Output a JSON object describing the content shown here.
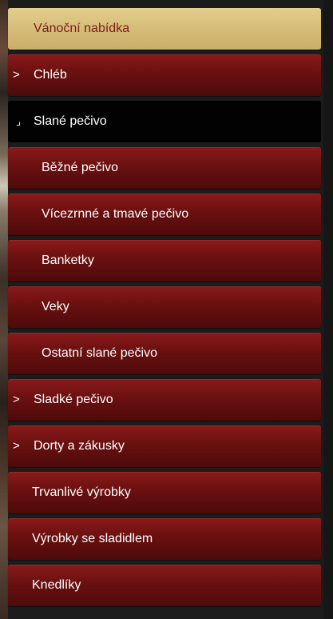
{
  "menu": {
    "items": [
      {
        "label": "Vánoční nabídka",
        "type": "highlight",
        "arrow": ""
      },
      {
        "label": "Chléb",
        "type": "top",
        "arrow": ">"
      },
      {
        "label": "Slané pečivo",
        "type": "active",
        "arrow": "⌟"
      },
      {
        "label": "Běžné pečivo",
        "type": "sub",
        "arrow": ""
      },
      {
        "label": "Vícezrnné a tmavé pečivo",
        "type": "sub",
        "arrow": ""
      },
      {
        "label": "Banketky",
        "type": "sub",
        "arrow": ""
      },
      {
        "label": "Veky",
        "type": "sub",
        "arrow": ""
      },
      {
        "label": "Ostatní slané pečivo",
        "type": "sub",
        "arrow": ""
      },
      {
        "label": "Sladké pečivo",
        "type": "top",
        "arrow": ">"
      },
      {
        "label": "Dorty a zákusky",
        "type": "top",
        "arrow": ">"
      },
      {
        "label": "Trvanlivé výrobky",
        "type": "top",
        "arrow": ""
      },
      {
        "label": "Výrobky se sladidlem",
        "type": "top",
        "arrow": ""
      },
      {
        "label": "Knedlíky",
        "type": "top",
        "arrow": ""
      }
    ]
  },
  "colors": {
    "highlight_bg": "#d6bd78",
    "highlight_text": "#7a1c1c",
    "item_bg": "#6a1010",
    "active_bg": "#020202",
    "text": "#ffffff"
  }
}
